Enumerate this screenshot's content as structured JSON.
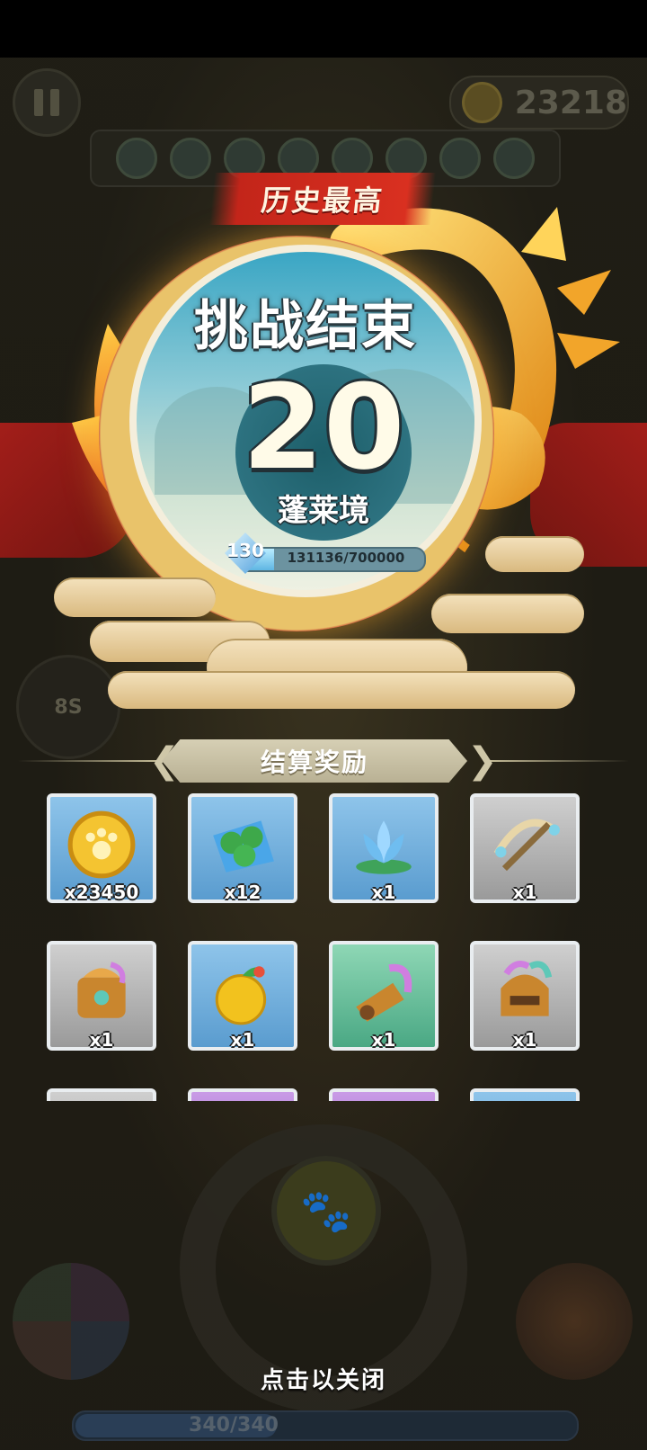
{
  "hud": {
    "coins": "23218",
    "timer": "8S",
    "hp": "340/340"
  },
  "result": {
    "badge": "历史最高",
    "title": "挑战结束",
    "score": "20",
    "realm": "蓬莱境",
    "level": "130",
    "xp": "131136/700000",
    "xp_progress": 0.187
  },
  "rewards": {
    "header": "结算奖励",
    "items": [
      {
        "icon": "paw-coin-icon",
        "qty": "x23450",
        "rarity": "blue"
      },
      {
        "icon": "green-pills-icon",
        "qty": "x12",
        "rarity": "blue"
      },
      {
        "icon": "blue-lotus-icon",
        "qty": "x1",
        "rarity": "blue"
      },
      {
        "icon": "crossbow-icon",
        "qty": "x1",
        "rarity": "gray"
      },
      {
        "icon": "qilin-armor-icon",
        "qty": "x1",
        "rarity": "gray"
      },
      {
        "icon": "golden-fruit-icon",
        "qty": "x1",
        "rarity": "blue"
      },
      {
        "icon": "qilin-bracer-icon",
        "qty": "x1",
        "rarity": "green"
      },
      {
        "icon": "qilin-helmet-icon",
        "qty": "x1",
        "rarity": "gray"
      },
      {
        "icon": "partial-item-icon",
        "qty": "",
        "rarity": "gray"
      },
      {
        "icon": "partial-item-icon",
        "qty": "",
        "rarity": "purple"
      },
      {
        "icon": "partial-item-icon",
        "qty": "",
        "rarity": "purple"
      },
      {
        "icon": "partial-item-icon",
        "qty": "",
        "rarity": "blue"
      }
    ]
  },
  "close_hint": "点击以关闭",
  "colors": {
    "ribbon": "#d93020",
    "blue_tile": "#6aa8d8",
    "gray_tile": "#b5b5b5",
    "green_tile": "#5fbf95",
    "purple_tile": "#a674d4"
  }
}
